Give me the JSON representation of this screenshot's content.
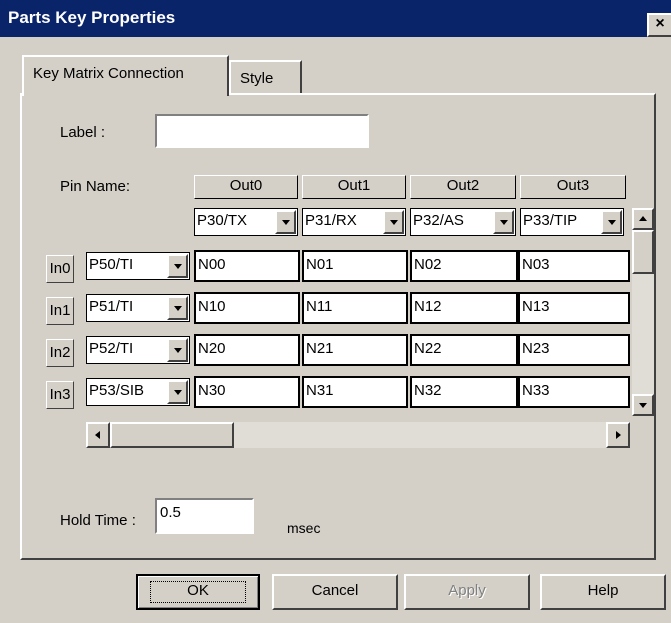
{
  "window": {
    "title": "Parts Key Properties",
    "close_glyph": "×",
    "colors": {
      "titlebar": "#0a246a",
      "face": "#d4d0c8"
    }
  },
  "tabs": [
    {
      "label": "Key Matrix Connection",
      "active": true
    },
    {
      "label": "Style",
      "active": false
    }
  ],
  "form": {
    "label_caption": "Label :",
    "label_value": "",
    "pin_name_caption": "Pin Name:",
    "hold_time_caption": "Hold Time :",
    "hold_time_value": "0.5",
    "hold_time_unit": "msec"
  },
  "matrix": {
    "out_headers": [
      "Out0",
      "Out1",
      "Out2",
      "Out3"
    ],
    "out_pins": [
      "P30/TX",
      "P31/RX",
      "P32/AS",
      "P33/TIP"
    ],
    "rows": [
      {
        "in_label": "In0",
        "pin": "P50/TI",
        "cells": [
          "N00",
          "N01",
          "N02",
          "N03"
        ]
      },
      {
        "in_label": "In1",
        "pin": "P51/TI",
        "cells": [
          "N10",
          "N11",
          "N12",
          "N13"
        ]
      },
      {
        "in_label": "In2",
        "pin": "P52/TI",
        "cells": [
          "N20",
          "N21",
          "N22",
          "N23"
        ]
      },
      {
        "in_label": "In3",
        "pin": "P53/SIB",
        "cells": [
          "N30",
          "N31",
          "N32",
          "N33"
        ]
      }
    ]
  },
  "buttons": {
    "ok": "OK",
    "cancel": "Cancel",
    "apply": "Apply",
    "help": "Help"
  }
}
